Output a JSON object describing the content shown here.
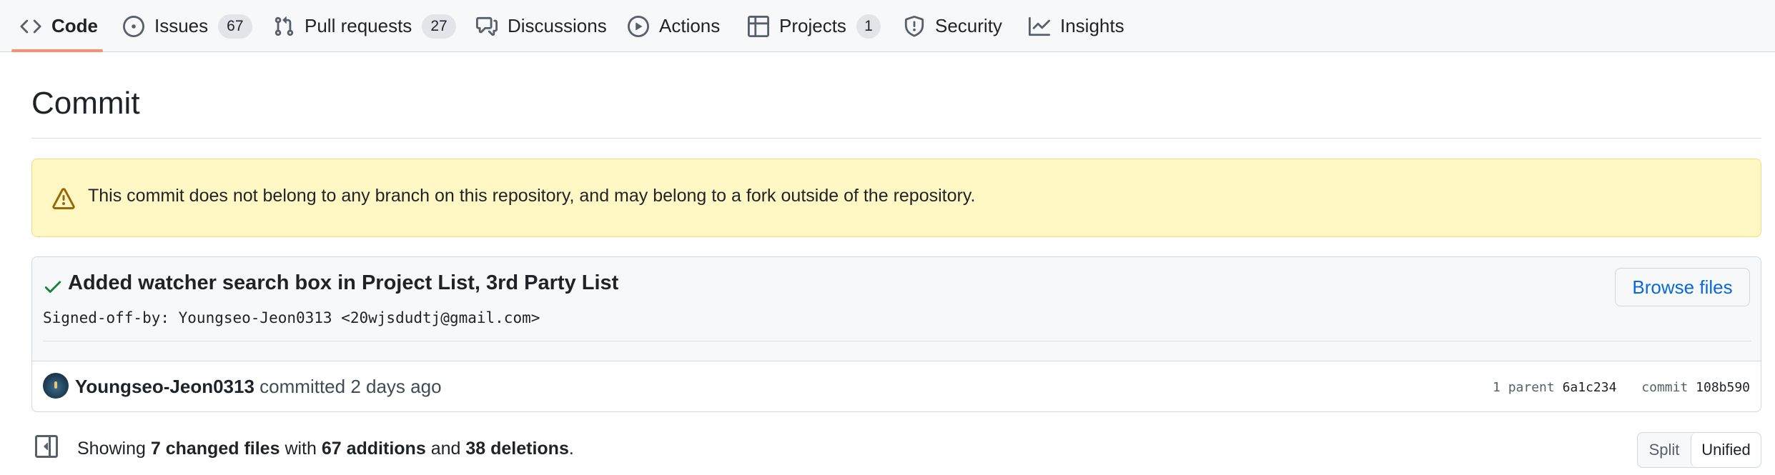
{
  "nav": {
    "tabs": [
      {
        "label": "Code",
        "icon": "code-icon",
        "counter": null,
        "selected": true
      },
      {
        "label": "Issues",
        "icon": "issue-opened-icon",
        "counter": "67"
      },
      {
        "label": "Pull requests",
        "icon": "git-pull-request-icon",
        "counter": "27"
      },
      {
        "label": "Discussions",
        "icon": "comment-discussion-icon",
        "counter": null
      },
      {
        "label": "Actions",
        "icon": "play-icon",
        "counter": null
      },
      {
        "label": "Projects",
        "icon": "table-icon",
        "counter": "1"
      },
      {
        "label": "Security",
        "icon": "shield-icon",
        "counter": null
      },
      {
        "label": "Insights",
        "icon": "graph-icon",
        "counter": null
      }
    ],
    "selected_underline_color": "#fd8c73"
  },
  "page": {
    "title": "Commit"
  },
  "flash": {
    "icon": "alert-icon",
    "message": "This commit does not belong to any branch on this repository, and may belong to a fork outside of the repository."
  },
  "commit": {
    "status_icon": "check-icon",
    "title": "Added watcher search box in Project List, 3rd Party List",
    "description": "Signed-off-by: Youngseo-Jeon0313 <20wjsdudtj@gmail.com>",
    "browse_label": "Browse files",
    "author": "Youngseo-Jeon0313",
    "action": "committed",
    "time": "2 days ago",
    "parent_label": "1 parent",
    "parent_sha": "6a1c234",
    "commit_label": "commit",
    "commit_sha": "108b590"
  },
  "diff": {
    "showing": "Showing",
    "changed_files": "7 changed files",
    "with": "with",
    "additions": "67 additions",
    "and": "and",
    "deletions": "38 deletions",
    "period": ".",
    "split_label": "Split",
    "unified_label": "Unified",
    "selected_view": "Unified"
  },
  "colors": {
    "link": "#0969da",
    "success": "#1a7f37",
    "warning_bg": "#fff8c5",
    "warning_icon": "#9a6700"
  }
}
